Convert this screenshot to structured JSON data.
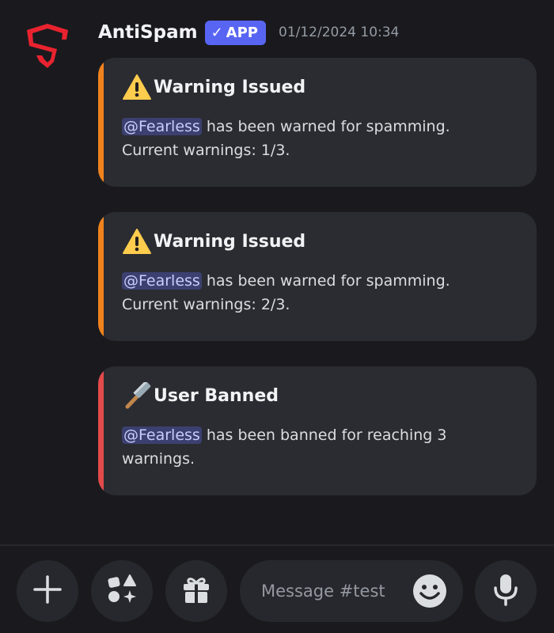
{
  "message": {
    "author": "AntiSpam",
    "badge": {
      "check": "✓",
      "label": "APP"
    },
    "timestamp": "01/12/2024 10:34",
    "avatar_icon": "antispam-shield-logo"
  },
  "embeds": [
    {
      "accent_color": "#f0821e",
      "emoji": "warning-icon",
      "title": "Warning Issued",
      "mention": "@Fearless",
      "line1": " has been warned for spamming.",
      "line2": "Current warnings: 1/3."
    },
    {
      "accent_color": "#f0821e",
      "emoji": "warning-icon",
      "title": "Warning Issued",
      "mention": "@Fearless",
      "line1": " has been warned for spamming.",
      "line2": "Current warnings: 2/3."
    },
    {
      "accent_color": "#e34a4a",
      "emoji": "hammer-icon",
      "title": "User Banned",
      "mention": "@Fearless",
      "line1": " has been banned for reaching 3",
      "line2": "warnings."
    }
  ],
  "composer": {
    "placeholder": "Message #test",
    "buttons": [
      "plus-icon",
      "apps-icon",
      "gift-icon",
      "emoji-icon",
      "microphone-icon"
    ]
  },
  "colors": {
    "background": "#1a1a1e",
    "embed_background": "#2b2c31",
    "brand_badge": "#5865f2",
    "mention_bg": "#3c4070",
    "warning_accent": "#f0821e",
    "ban_accent": "#e34a4a"
  }
}
